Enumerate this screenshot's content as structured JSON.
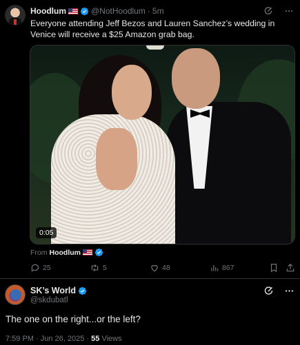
{
  "tweet1": {
    "display_name": "Hoodlum",
    "handle": "@NotHoodlum",
    "separator": "·",
    "age": "5m",
    "text": "Everyone attending Jeff Bezos and Lauren Sanchez’s wedding in Venice will receive a $25 Amazon grab bag.",
    "video_duration": "0:05",
    "source_prefix": "From",
    "source_name": "Hoodlum",
    "actions": {
      "replies": "25",
      "reposts": "5",
      "likes": "48",
      "views": "867"
    },
    "icons": [
      "grok-icon",
      "more-icon",
      "reply-icon",
      "repost-icon",
      "like-icon",
      "views-icon",
      "bookmark-icon",
      "share-icon"
    ]
  },
  "tweet2": {
    "display_name": "SK’s World",
    "handle": "@skdubatl",
    "text": "The one on the right...or the left?",
    "timestamp": "7:59 PM · Jun 26, 2025 · ",
    "views_count": "55",
    "views_label": " Views"
  },
  "colors": {
    "background": "#000000",
    "text": "#e7e9ea",
    "muted": "#71767b",
    "verified": "#1d9bf0",
    "divider": "#2f3336"
  }
}
